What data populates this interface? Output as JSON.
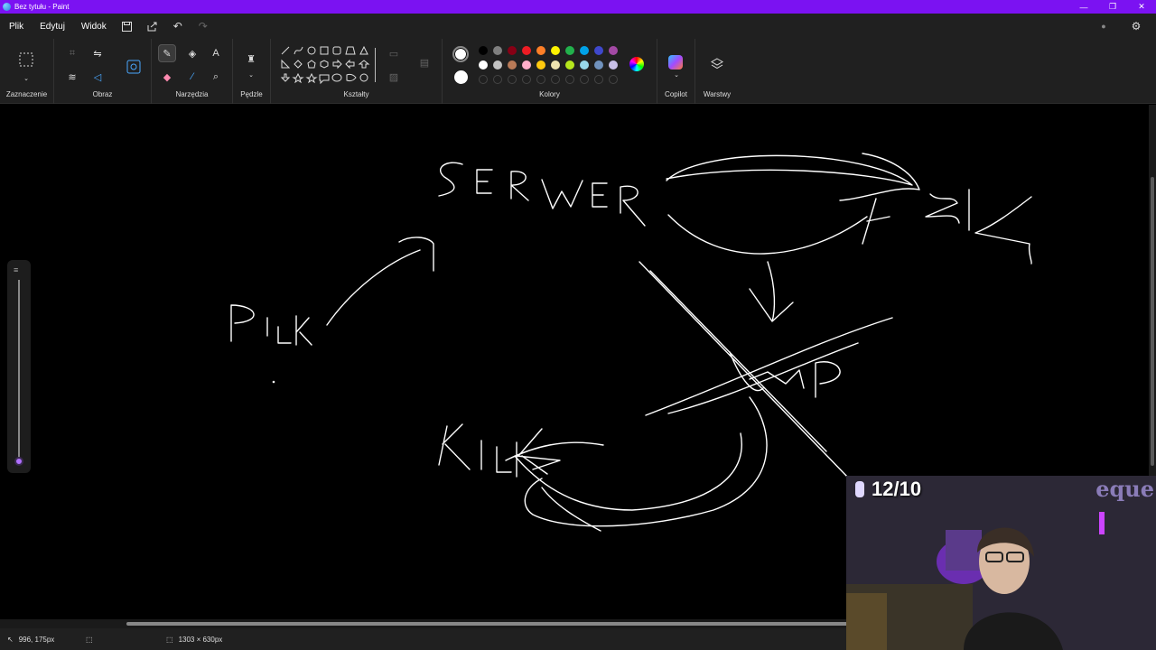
{
  "window": {
    "title": "Bez tytułu - Paint"
  },
  "menu": {
    "items": [
      "Plik",
      "Edytuj",
      "Widok"
    ]
  },
  "ribbon": {
    "groups": {
      "selection": "Zaznaczenie",
      "image": "Obraz",
      "tools": "Narzędzia",
      "brushes": "Pędzle",
      "shapes": "Kształty",
      "colors": "Kolory",
      "copilot": "Copilot",
      "layers": "Warstwy"
    }
  },
  "colors": {
    "primary": "#ffffff",
    "secondary": "#ffffff",
    "palette_row1": [
      "#000000",
      "#7f7f7f",
      "#880015",
      "#ed1c24",
      "#ff7f27",
      "#fff200",
      "#22b14c",
      "#00a2e8",
      "#3f48cc",
      "#a349a4"
    ],
    "palette_row2": [
      "#ffffff",
      "#c3c3c3",
      "#b97a57",
      "#ffaec9",
      "#ffc90e",
      "#efe4b0",
      "#b5e61d",
      "#99d9ea",
      "#7092be",
      "#c8bfe7"
    ]
  },
  "canvas": {
    "drawing_labels": {
      "serwer": "SERWER",
      "plik": "PIK",
      "klient": "KIL",
      "komp": "KOMP"
    }
  },
  "status": {
    "cursor_pos": "996, 175px",
    "canvas_size": "1303 × 630px"
  },
  "overlay": {
    "counter": "12/10",
    "brand": "eque"
  }
}
